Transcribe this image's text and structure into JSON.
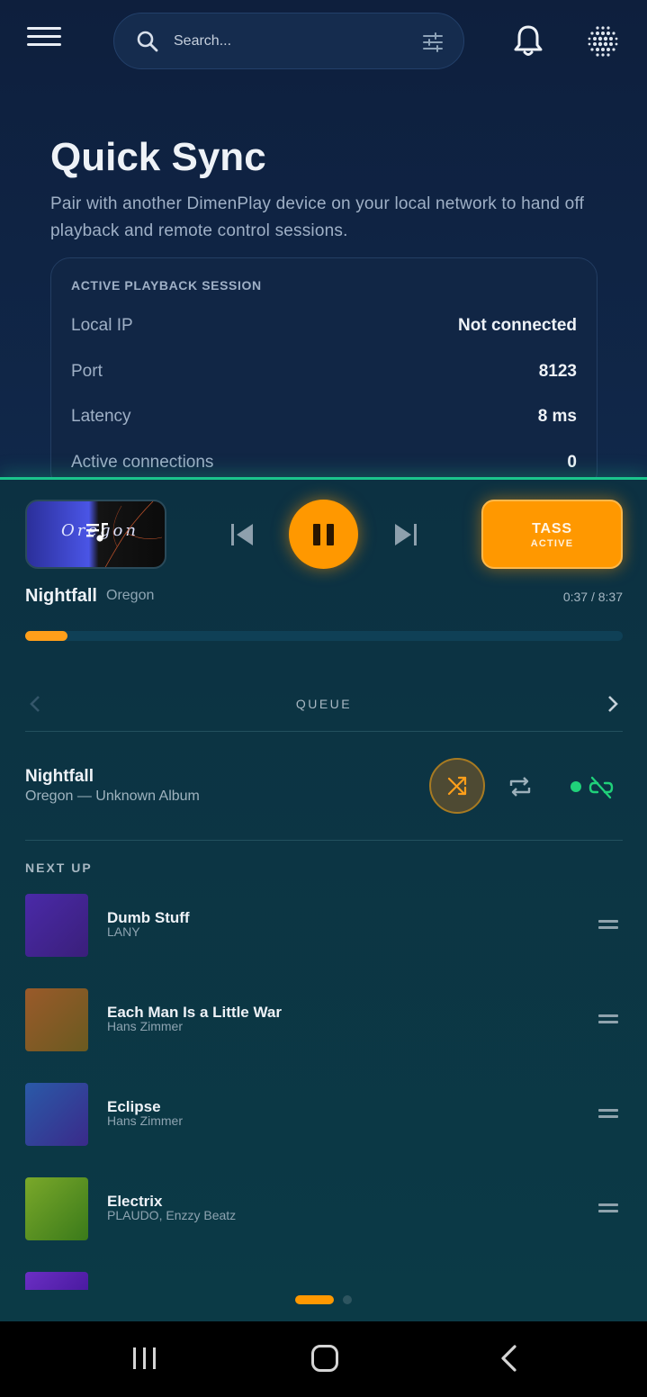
{
  "header": {
    "search_placeholder": "Search...",
    "icons": [
      "menu-icon",
      "search-icon",
      "filter-icon",
      "bell-icon",
      "dots-grid-icon"
    ]
  },
  "quick_sync": {
    "title": "Quick Sync",
    "description": "Pair with another DimenPlay device on your local network to hand off playback and remote control sessions.",
    "card_heading": "ACTIVE PLAYBACK SESSION",
    "rows": [
      {
        "label": "Local IP",
        "value": "Not connected"
      },
      {
        "label": "Port",
        "value": "8123"
      },
      {
        "label": "Latency",
        "value": "8 ms"
      },
      {
        "label": "Active connections",
        "value": "0"
      }
    ]
  },
  "player": {
    "album_art_text": "Oregon",
    "tass_label": "TASS",
    "tass_status": "ACTIVE",
    "track_title": "Nightfall",
    "track_artist": "Oregon",
    "time": "0:37 / 8:37",
    "progress_fraction": 0.071,
    "queue_label": "QUEUE",
    "current": {
      "title": "Nightfall",
      "subtitle": "Oregon — Unknown Album"
    },
    "next_up_label": "NEXT UP",
    "queue": [
      {
        "title": "Dumb Stuff",
        "artist": "LANY",
        "color_a": "#4a2aa8",
        "color_b": "#3a1f7a"
      },
      {
        "title": "Each Man Is a Little War",
        "artist": "Hans Zimmer",
        "color_a": "#9a5a2a",
        "color_b": "#6a5a20"
      },
      {
        "title": "Eclipse",
        "artist": "Hans Zimmer",
        "color_a": "#2a5aa8",
        "color_b": "#3a2a8a"
      },
      {
        "title": "Electrix",
        "artist": "PLAUDO, Enzzy Beatz",
        "color_a": "#7aa82a",
        "color_b": "#3a7a1a"
      }
    ],
    "colors": {
      "accent": "#ff9800",
      "connected": "#20d17a"
    }
  }
}
